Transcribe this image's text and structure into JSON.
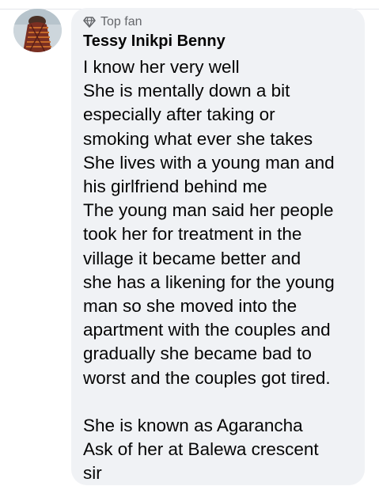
{
  "comment": {
    "badge_label": "Top fan",
    "badge_icon": "diamond-icon",
    "author": "Tessy Inikpi Benny",
    "text": "I know her very well\nShe is mentally down a bit\nespecially after taking or\nsmoking what ever she takes\nShe lives with a young man and\nhis girlfriend behind me\nThe young man said her people\ntook her for treatment in the\nvillage it became better and\nshe has a likening for the young\nman so she moved into the\napartment with the couples and\ngradually she became bad to\nworst and the couples got tired.\n\nShe is known as Agarancha\nAsk of her at Balewa crescent\nsir"
  }
}
